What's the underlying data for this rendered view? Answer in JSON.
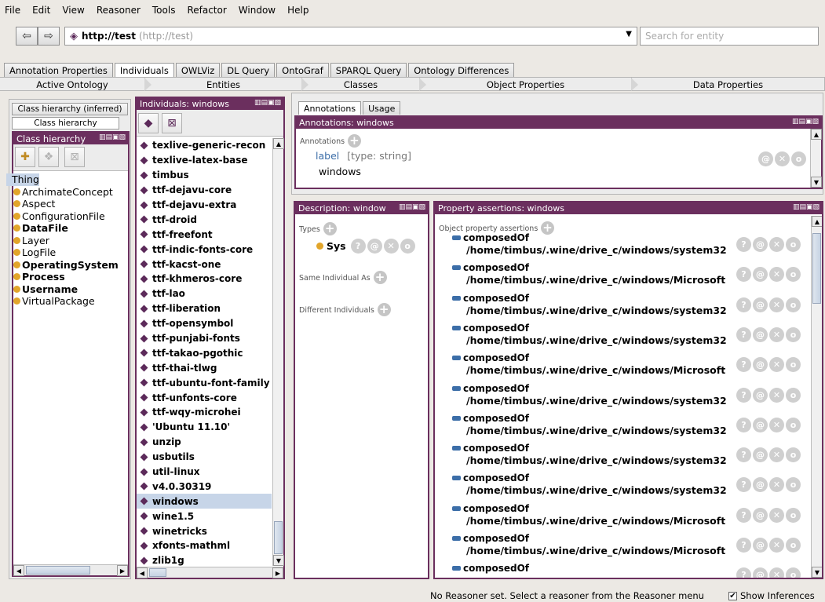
{
  "menu": [
    "File",
    "Edit",
    "View",
    "Reasoner",
    "Tools",
    "Refactor",
    "Window",
    "Help"
  ],
  "address": {
    "url": "http://test",
    "url_hint": "(http://test)",
    "search_placeholder": "Search for entity"
  },
  "tabs_row1": [
    "Annotation Properties",
    "Individuals",
    "OWLViz",
    "DL Query",
    "OntoGraf",
    "SPARQL Query",
    "Ontology Differences"
  ],
  "tabs_row1_active": "Individuals",
  "tabs_row2": [
    "Active Ontology",
    "Entities",
    "Classes",
    "Object Properties",
    "Data Properties"
  ],
  "class_panel": {
    "tab_inferred": "Class hierarchy (inferred)",
    "tab_asserted": "Class hierarchy",
    "title": "Class hierarchy",
    "items": [
      {
        "label": "Thing",
        "bold": false,
        "dot": false
      },
      {
        "label": "ArchimateConcept",
        "bold": false,
        "dot": true
      },
      {
        "label": "Aspect",
        "bold": false,
        "dot": true
      },
      {
        "label": "ConfigurationFile",
        "bold": false,
        "dot": true
      },
      {
        "label": "DataFile",
        "bold": true,
        "dot": true
      },
      {
        "label": "Layer",
        "bold": false,
        "dot": true
      },
      {
        "label": "LogFile",
        "bold": false,
        "dot": true
      },
      {
        "label": "OperatingSystem",
        "bold": true,
        "dot": true
      },
      {
        "label": "Process",
        "bold": true,
        "dot": true
      },
      {
        "label": "Username",
        "bold": true,
        "dot": true
      },
      {
        "label": "VirtualPackage",
        "bold": false,
        "dot": true
      }
    ]
  },
  "individuals_panel": {
    "title": "Individuals: windows",
    "items": [
      "texlive-generic-recon",
      "texlive-latex-base",
      "timbus",
      "ttf-dejavu-core",
      "ttf-dejavu-extra",
      "ttf-droid",
      "ttf-freefont",
      "ttf-indic-fonts-core",
      "ttf-kacst-one",
      "ttf-khmeros-core",
      "ttf-lao",
      "ttf-liberation",
      "ttf-opensymbol",
      "ttf-punjabi-fonts",
      "ttf-takao-pgothic",
      "ttf-thai-tlwg",
      "ttf-ubuntu-font-family",
      "ttf-unfonts-core",
      "ttf-wqy-microhei",
      "'Ubuntu 11.10'",
      "unzip",
      "usbutils",
      "util-linux",
      "v4.0.30319",
      "windows",
      "wine1.5",
      "winetricks",
      "xfonts-mathml",
      "zlib1g"
    ],
    "selected": "windows"
  },
  "annotations_panel": {
    "tabs": [
      "Annotations",
      "Usage"
    ],
    "title": "Annotations: windows",
    "section_label": "Annotations",
    "label_key": "label",
    "label_type": "[type: string]",
    "label_value": "windows"
  },
  "description_panel": {
    "title": "Description: window",
    "types_label": "Types",
    "type_value": "Sys",
    "same_label": "Same Individual As",
    "different_label": "Different Individuals"
  },
  "property_panel": {
    "title": "Property assertions: windows",
    "section_label": "Object property assertions",
    "rows": [
      {
        "prop": "composedOf",
        "value": "/home/timbus/.wine/drive_c/windows/system32"
      },
      {
        "prop": "composedOf",
        "value": "/home/timbus/.wine/drive_c/windows/Microsoft"
      },
      {
        "prop": "composedOf",
        "value": "/home/timbus/.wine/drive_c/windows/system32"
      },
      {
        "prop": "composedOf",
        "value": "/home/timbus/.wine/drive_c/windows/system32"
      },
      {
        "prop": "composedOf",
        "value": "/home/timbus/.wine/drive_c/windows/Microsoft"
      },
      {
        "prop": "composedOf",
        "value": "/home/timbus/.wine/drive_c/windows/system32"
      },
      {
        "prop": "composedOf",
        "value": "/home/timbus/.wine/drive_c/windows/system32"
      },
      {
        "prop": "composedOf",
        "value": "/home/timbus/.wine/drive_c/windows/system32"
      },
      {
        "prop": "composedOf",
        "value": "/home/timbus/.wine/drive_c/windows/system32"
      },
      {
        "prop": "composedOf",
        "value": "/home/timbus/.wine/drive_c/windows/Microsoft"
      },
      {
        "prop": "composedOf",
        "value": "/home/timbus/.wine/drive_c/windows/Microsoft"
      },
      {
        "prop": "composedOf",
        "value": ""
      }
    ]
  },
  "status": {
    "message": "No Reasoner set. Select a reasoner from the Reasoner menu",
    "show_inferences": "Show Inferences"
  },
  "colors": {
    "title_bar": "#6b2f5e",
    "selection": "#c7d5e8",
    "class_dot": "#e2a52a",
    "individual_diamond": "#5c2a5a",
    "label_link": "#3c6ea8"
  },
  "icons": {
    "back": "back-arrow-icon",
    "forward": "forward-arrow-icon",
    "ontology": "ontology-diamond-icon",
    "add_class": "add-subclass-icon",
    "add_sibling": "add-sibling-icon",
    "delete_class": "delete-class-icon",
    "add_individual": "add-individual-icon",
    "delete_individual": "delete-individual-icon"
  }
}
